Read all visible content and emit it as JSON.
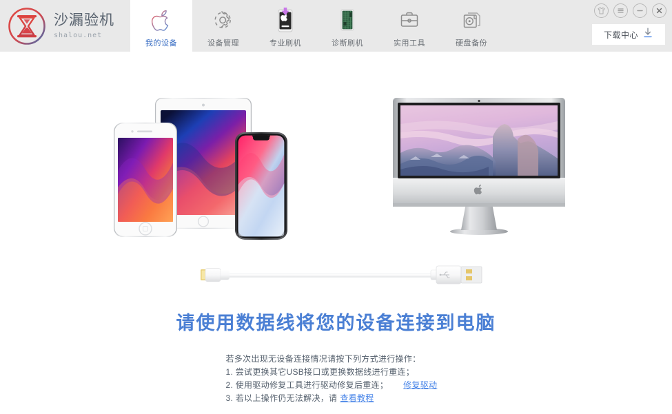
{
  "window": {
    "brand_title": "沙漏验机",
    "brand_sub": "shalou.net",
    "brand_logo_icon": "hourglass-logo-icon",
    "controls": [
      {
        "name": "skin-theme-button",
        "icon": "tshirt-icon",
        "label": ""
      },
      {
        "name": "menu-button",
        "icon": "hamburger-menu-icon",
        "label": ""
      },
      {
        "name": "minimize-button",
        "icon": "minimize-icon",
        "label": ""
      },
      {
        "name": "close-button",
        "icon": "close-icon",
        "label": ""
      }
    ],
    "download_center": {
      "label": "下载中心",
      "icon": "download-arrow-icon"
    }
  },
  "nav": {
    "tabs": [
      {
        "label": "我的设备",
        "icon": "apple-logo-icon",
        "active": true
      },
      {
        "label": "设备管理",
        "icon": "gear-icon",
        "active": false
      },
      {
        "label": "专业刷机",
        "icon": "device-flash-icon",
        "active": false
      },
      {
        "label": "诊断刷机",
        "icon": "circuit-board-icon",
        "active": false
      },
      {
        "label": "实用工具",
        "icon": "toolbox-icon",
        "active": false
      },
      {
        "label": "硬盘备份",
        "icon": "disk-stack-icon",
        "active": false
      }
    ]
  },
  "main": {
    "devices_image_alt": "iphone-ipad-iphonex-group",
    "computer_image_alt": "imac-desktop",
    "cable_image_alt": "lightning-usb-cable",
    "headline": "请使用数据线将您的设备连接到电脑",
    "help": {
      "title": "若多次出现无设备连接情况请按下列方式进行操作：",
      "lines": [
        {
          "text": "1. 尝试更换其它USB接口或更换数据线进行重连；",
          "link": ""
        },
        {
          "text": "2. 使用驱动修复工具进行驱动修复后重连；",
          "link": "修复驱动"
        },
        {
          "text": "3. 若以上操作仍无法解决，请",
          "link": "查看教程"
        }
      ]
    }
  },
  "colors": {
    "header_bg": "#e9e9e9",
    "accent_blue": "#4a7fd4",
    "link_blue": "#4a86e8",
    "text_gray": "#55606d",
    "tab_active_text": "#3b6fc4"
  }
}
